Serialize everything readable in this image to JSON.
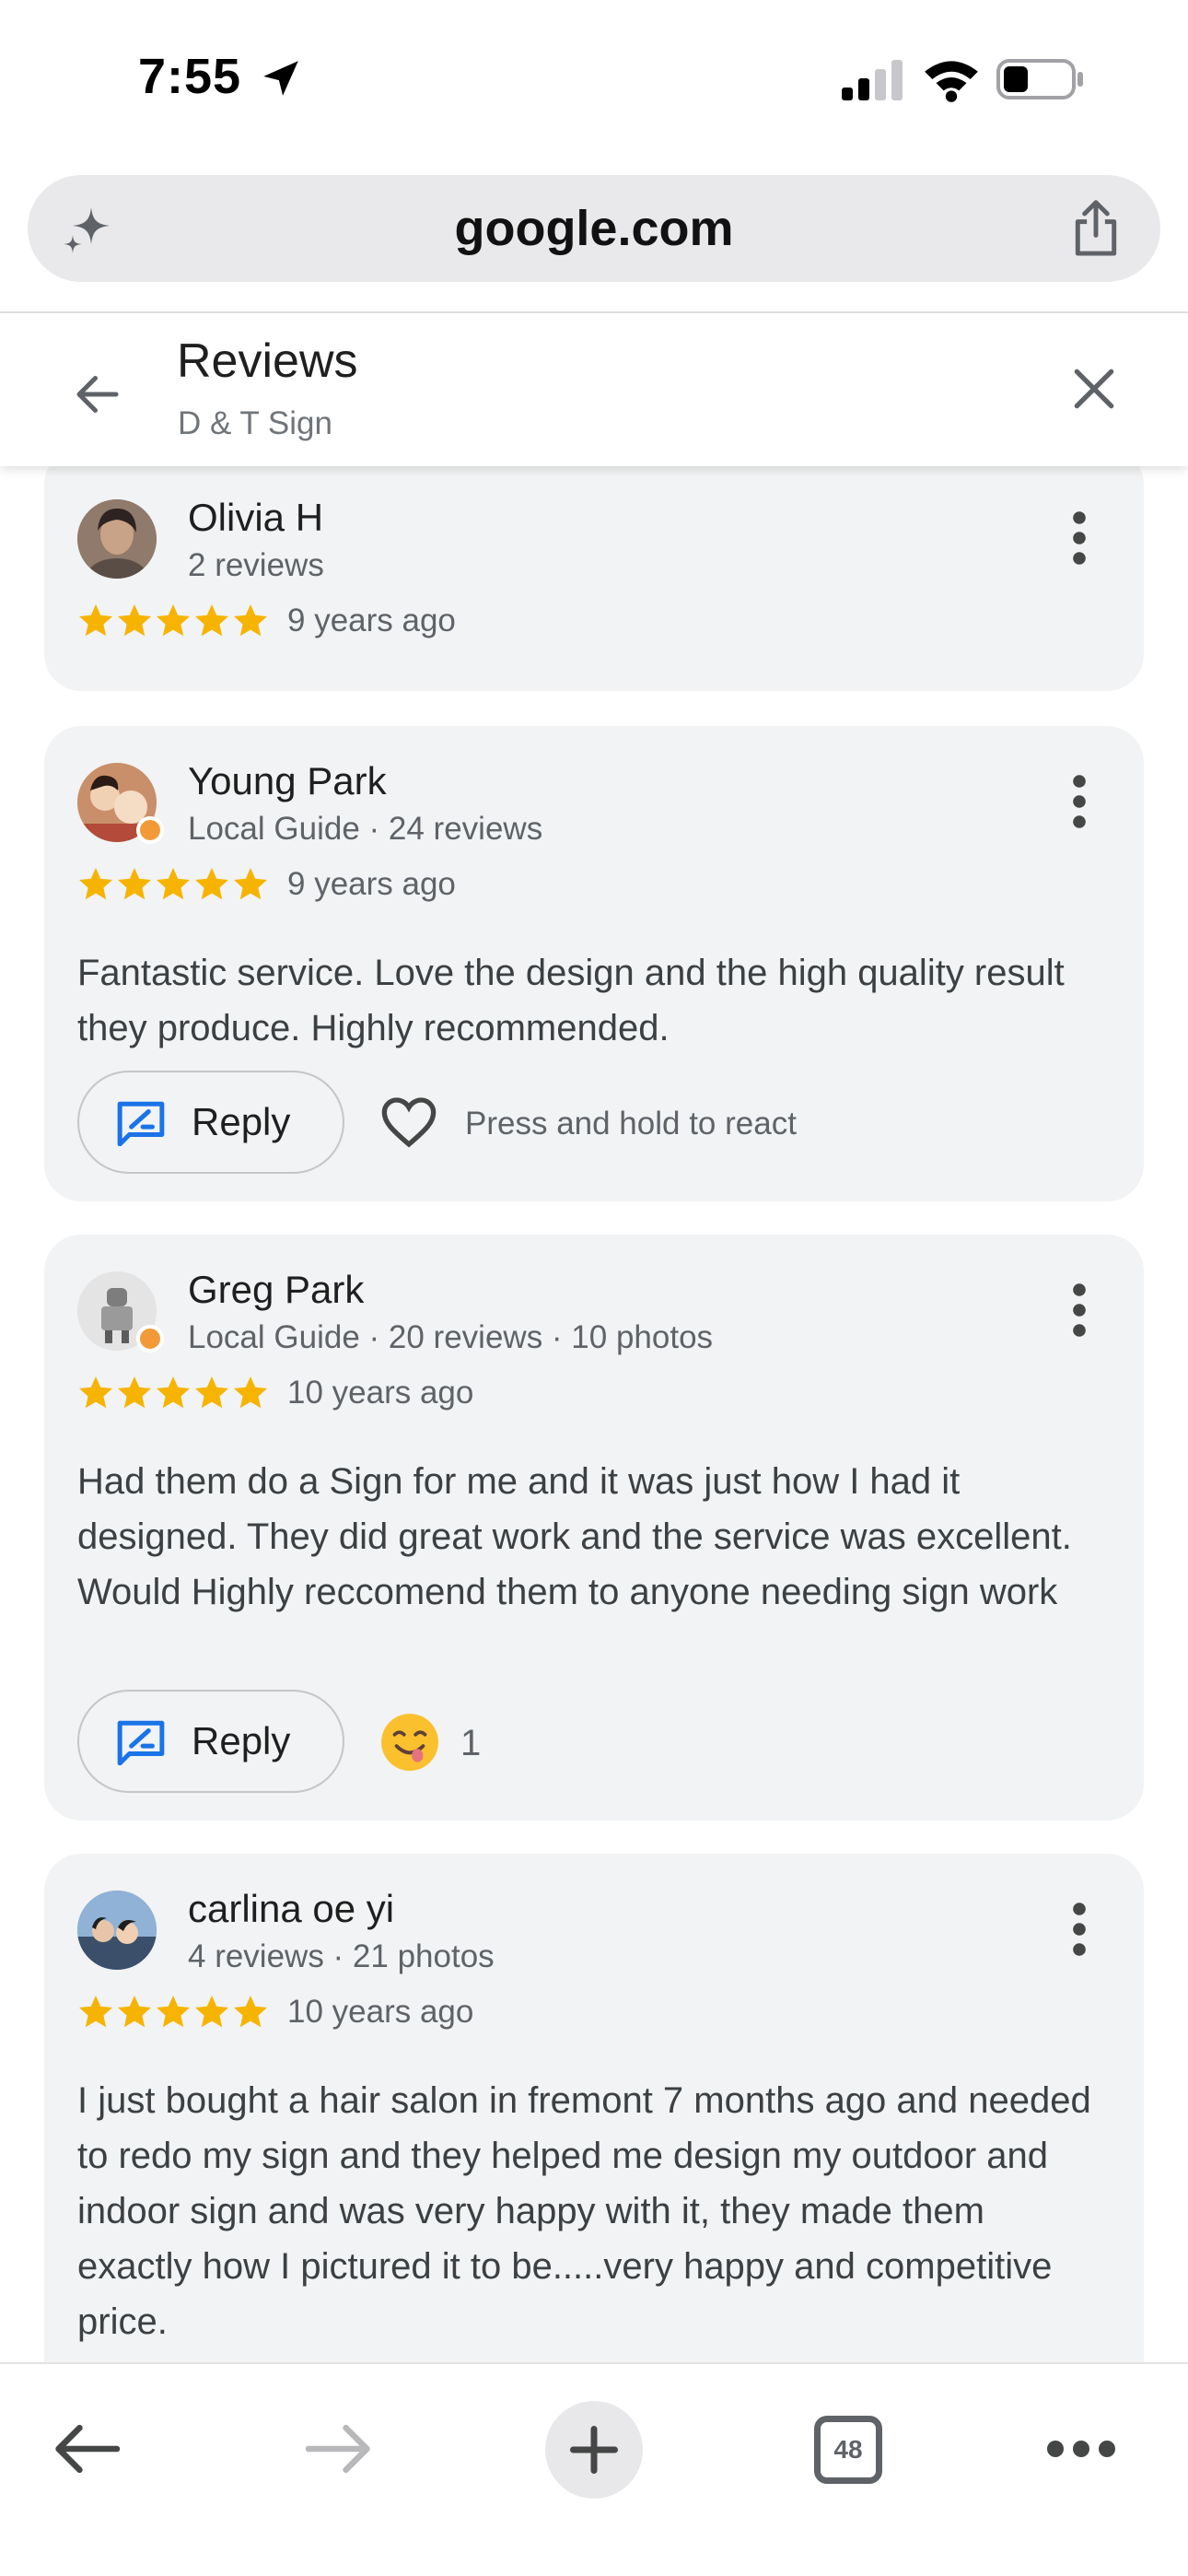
{
  "status_bar": {
    "time": "7:55"
  },
  "browser": {
    "url": "google.com",
    "tab_count": "48"
  },
  "header": {
    "title": "Reviews",
    "subtitle": "D & T Sign"
  },
  "reviews": [
    {
      "name": "Olivia H",
      "meta": "2 reviews",
      "rating": 5,
      "date": "9 years ago",
      "text": ""
    },
    {
      "name": "Young Park",
      "meta": "Local Guide · 24 reviews",
      "rating": 5,
      "date": "9 years ago",
      "text": "Fantastic service. Love the design and the high quality result they produce. Highly recommended.",
      "reply_label": "Reply",
      "react_hint": "Press and hold to react"
    },
    {
      "name": "Greg Park",
      "meta": "Local Guide · 20 reviews · 10 photos",
      "rating": 5,
      "date": "10 years ago",
      "text": "Had them do a Sign for me and it was just how I had it designed. They did great work and the service was excellent. Would Highly reccomend them to anyone needing sign work",
      "reply_label": "Reply",
      "reaction_count": "1",
      "reaction_icon": "smiling-face-emoji"
    },
    {
      "name": "carlina oe yi",
      "meta": "4 reviews · 21 photos",
      "rating": 5,
      "date": "10 years ago",
      "text": "I just bought a hair salon in fremont 7 months ago and needed to redo my sign and they helped me design my outdoor and indoor sign and was very happy with it, they made them exactly how I pictured it to be.....very happy and competitive price."
    }
  ],
  "colors": {
    "star": "#f6b400",
    "accent": "#1a73e8",
    "card": "#f1f3f4"
  }
}
